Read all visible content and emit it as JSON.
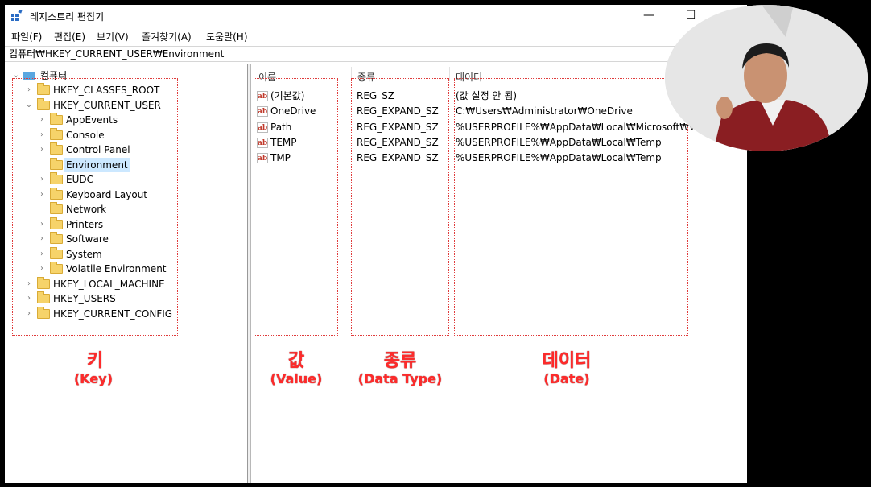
{
  "window": {
    "title": "레지스트리 편집기",
    "minimize_glyph": "—",
    "maximize_glyph": "☐"
  },
  "menu": [
    "파일(F)",
    "편집(E)",
    "보기(V)",
    "즐겨찾기(A)",
    "도움말(H)"
  ],
  "address": "컴퓨터₩HKEY_CURRENT_USER₩Environment",
  "tree": {
    "root": "컴퓨터",
    "hives": {
      "classes_root": "HKEY_CLASSES_ROOT",
      "current_user": "HKEY_CURRENT_USER",
      "local_machine": "HKEY_LOCAL_MACHINE",
      "users": "HKEY_USERS",
      "current_config": "HKEY_CURRENT_CONFIG"
    },
    "current_user_children": [
      "AppEvents",
      "Console",
      "Control Panel",
      "Environment",
      "EUDC",
      "Keyboard Layout",
      "Network",
      "Printers",
      "Software",
      "System",
      "Volatile Environment"
    ],
    "selected": "Environment"
  },
  "columns": {
    "name": "이름",
    "type": "종류",
    "data": "데이터"
  },
  "values": [
    {
      "name": "(기본값)",
      "type": "REG_SZ",
      "data": "(값 설정 안 됨)"
    },
    {
      "name": "OneDrive",
      "type": "REG_EXPAND_SZ",
      "data": "C:₩Users₩Administrator₩OneDrive"
    },
    {
      "name": "Path",
      "type": "REG_EXPAND_SZ",
      "data": "%USERPROFILE%₩AppData₩Local₩Microsoft₩W..."
    },
    {
      "name": "TEMP",
      "type": "REG_EXPAND_SZ",
      "data": "%USERPROFILE%₩AppData₩Local₩Temp"
    },
    {
      "name": "TMP",
      "type": "REG_EXPAND_SZ",
      "data": "%USERPROFILE%₩AppData₩Local₩Temp"
    }
  ],
  "value_icon_text": "ab",
  "annotations": [
    {
      "title": "키",
      "subtitle": "(Key)"
    },
    {
      "title": "값",
      "subtitle": "(Value)"
    },
    {
      "title": "종류",
      "subtitle": "(Data Type)"
    },
    {
      "title": "데이터",
      "subtitle": "(Date)"
    }
  ],
  "colors": {
    "annotation": "#ff2a2a",
    "selection": "#cce8ff"
  },
  "icons": {
    "app": "registry-editor-icon",
    "computer": "computer-icon",
    "folder": "folder-icon",
    "string_value": "string-value-icon",
    "expand": "chevron-right-icon",
    "collapse": "chevron-down-icon"
  }
}
